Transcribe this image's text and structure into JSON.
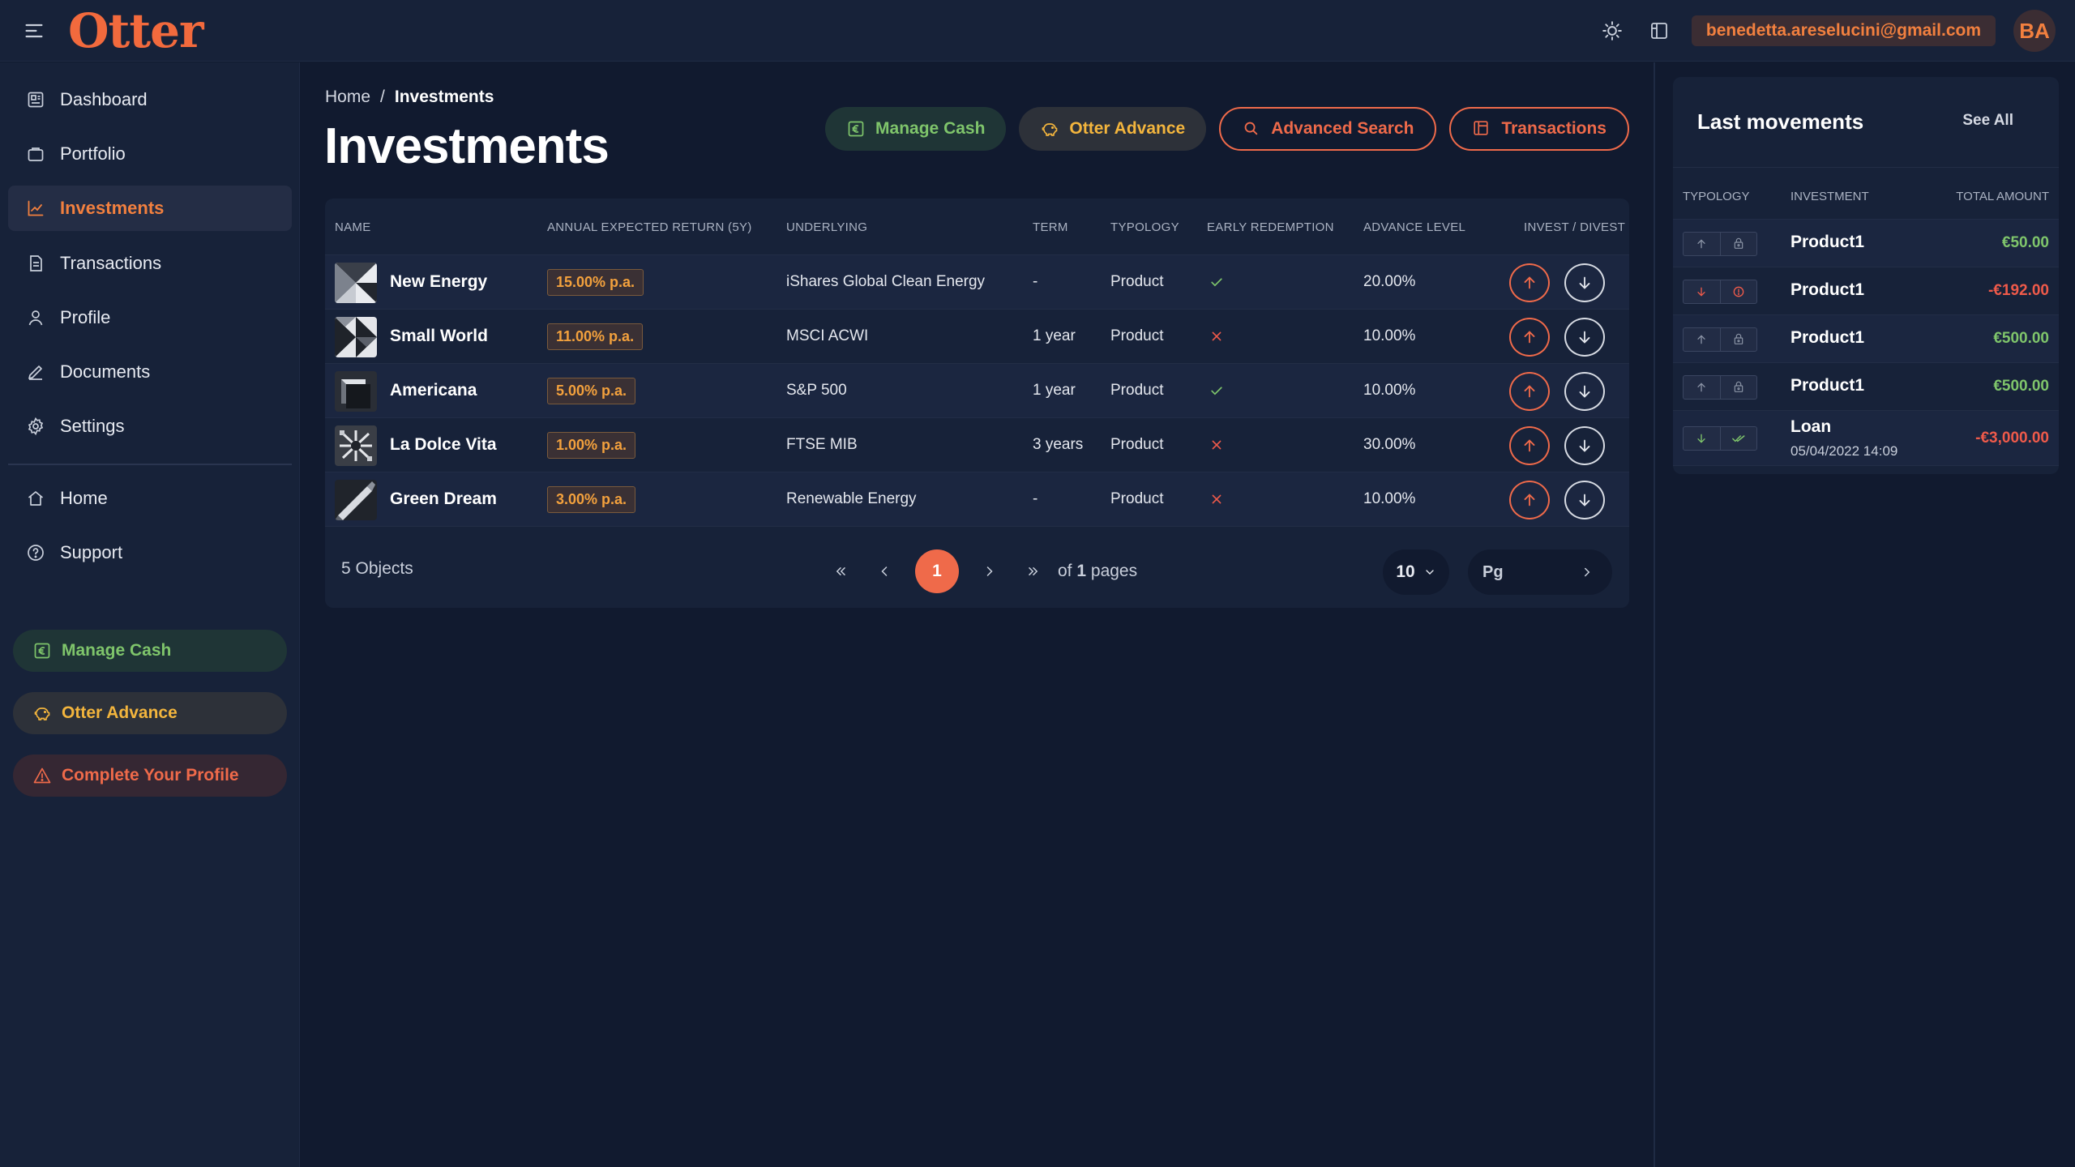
{
  "app": {
    "logo": "Otter",
    "email": "benedetta.areselucini@gmail.com",
    "avatar_initials": "BA"
  },
  "colors": {
    "accent": "#ef6a4a",
    "green": "#7fc56b",
    "yellow": "#f3b53d",
    "background": "#111a2f",
    "panel": "#172239"
  },
  "sidebar": {
    "items": [
      {
        "label": "Dashboard",
        "icon": "dashboard-icon"
      },
      {
        "label": "Portfolio",
        "icon": "portfolio-icon"
      },
      {
        "label": "Investments",
        "icon": "chart-icon",
        "active": true
      },
      {
        "label": "Transactions",
        "icon": "document-icon"
      },
      {
        "label": "Profile",
        "icon": "user-icon"
      },
      {
        "label": "Documents",
        "icon": "pen-icon"
      },
      {
        "label": "Settings",
        "icon": "gear-icon"
      },
      {
        "label": "Home",
        "icon": "home-icon"
      },
      {
        "label": "Support",
        "icon": "help-icon"
      }
    ],
    "buttons": {
      "manage_cash": "Manage Cash",
      "otter_advance": "Otter Advance",
      "complete_profile": "Complete Your Profile"
    }
  },
  "breadcrumb": {
    "home": "Home",
    "separator": "/",
    "current": "Investments"
  },
  "page": {
    "title": "Investments"
  },
  "actions": {
    "manage_cash": "Manage Cash",
    "otter_advance": "Otter Advance",
    "advanced_search": "Advanced Search",
    "transactions": "Transactions"
  },
  "table": {
    "headers": {
      "name": "NAME",
      "return": "ANNUAL EXPECTED RETURN (5Y)",
      "underlying": "UNDERLYING",
      "term": "TERM",
      "typology": "TYPOLOGY",
      "early": "EARLY REDEMPTION",
      "advance": "ADVANCE LEVEL",
      "invest": "INVEST / DIVEST"
    },
    "rows": [
      {
        "name": "New Energy",
        "return": "15.00% p.a.",
        "underlying": "iShares Global Clean Energy",
        "term": "-",
        "typology": "Product",
        "early": true,
        "advance": "20.00%"
      },
      {
        "name": "Small World",
        "return": "11.00% p.a.",
        "underlying": "MSCI ACWI",
        "term": "1 year",
        "typology": "Product",
        "early": false,
        "advance": "10.00%"
      },
      {
        "name": "Americana",
        "return": "5.00% p.a.",
        "underlying": "S&P 500",
        "term": "1 year",
        "typology": "Product",
        "early": true,
        "advance": "10.00%"
      },
      {
        "name": "La Dolce Vita",
        "return": "1.00% p.a.",
        "underlying": "FTSE MIB",
        "term": "3 years",
        "typology": "Product",
        "early": false,
        "advance": "30.00%"
      },
      {
        "name": "Green Dream",
        "return": "3.00% p.a.",
        "underlying": "Renewable Energy",
        "term": "-",
        "typology": "Product",
        "early": false,
        "advance": "10.00%"
      }
    ],
    "footer": {
      "count": "5 Objects",
      "current_page": "1",
      "of_prefix": "of",
      "total_pages": "1",
      "pages_suffix": "pages",
      "per_page": "10",
      "jump_placeholder": "Pg"
    }
  },
  "movements": {
    "title": "Last movements",
    "see_all": "See All",
    "headers": {
      "typology": "TYPOLOGY",
      "investment": "INVESTMENT",
      "total": "TOTAL AMOUNT"
    },
    "rows": [
      {
        "direction": "up",
        "kind": "bank",
        "investment": "Product1",
        "amount": "€50.00",
        "positive": true
      },
      {
        "direction": "down",
        "kind": "alert",
        "investment": "Product1",
        "amount": "-€192.00",
        "positive": false
      },
      {
        "direction": "up",
        "kind": "bank",
        "investment": "Product1",
        "amount": "€500.00",
        "positive": true
      },
      {
        "direction": "up",
        "kind": "bank",
        "investment": "Product1",
        "amount": "€500.00",
        "positive": true
      },
      {
        "direction": "down",
        "kind": "check",
        "investment": "Loan",
        "date": "05/04/2022 14:09",
        "amount": "-€3,000.00",
        "positive": false
      }
    ]
  }
}
